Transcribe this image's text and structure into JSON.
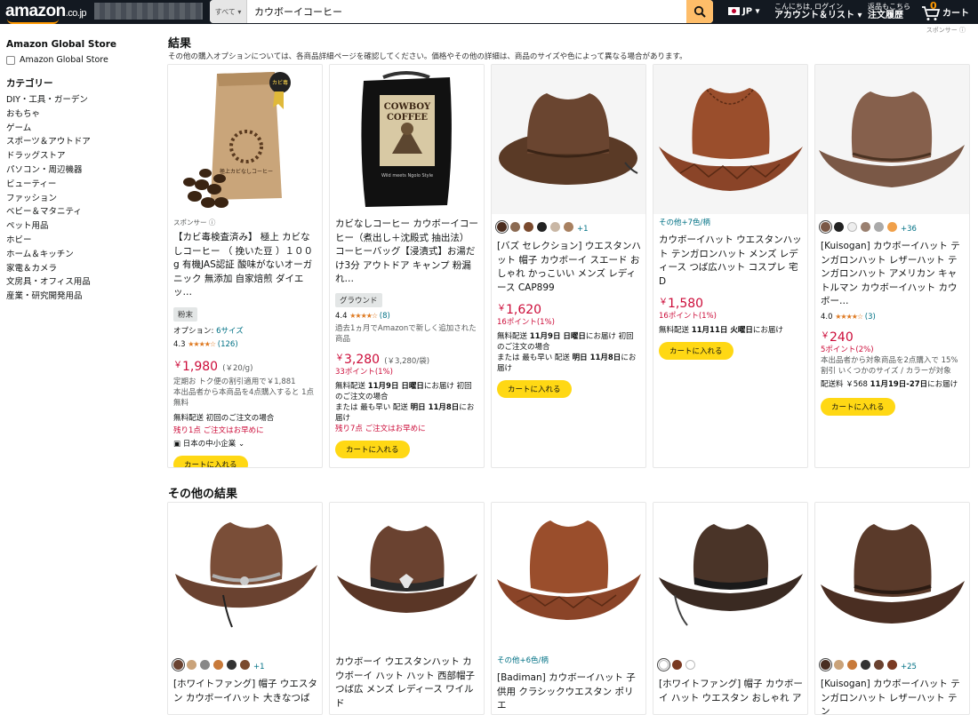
{
  "header": {
    "logo": "amazon",
    "logo_suffix": ".co.jp",
    "search_category": "すべて",
    "search_value": "カウボーイコーヒー",
    "lang": "JP",
    "greeting": "こんにちは, ログイン",
    "account": "アカウント＆リスト",
    "returns_line1": "返品もこちら",
    "returns_line2": "注文履歴",
    "cart_count": "0",
    "cart": "カート"
  },
  "sidebar": {
    "store_heading": "Amazon Global Store",
    "store_option": "Amazon Global Store",
    "category_heading": "カテゴリー",
    "categories": [
      "DIY・工具・ガーデン",
      "おもちゃ",
      "ゲーム",
      "スポーツ＆アウトドア",
      "ドラッグストア",
      "パソコン・周辺機器",
      "ビューティー",
      "ファッション",
      "ベビー＆マタニティ",
      "ペット用品",
      "ホビー",
      "ホーム＆キッチン",
      "家電＆カメラ",
      "文房具・オフィス用品",
      "産業・研究開発用品"
    ]
  },
  "results": {
    "heading": "結果",
    "subtitle": "その他の購入オプションについては、各商品詳細ページを確認してください。価格やその他の詳細は、商品のサイズや色によって異なる場合があります。",
    "sponsor_top": "スポンサー",
    "other_heading": "その他の結果"
  },
  "products": [
    {
      "sponsored": "スポンサー",
      "title": "【カビ毒検査済み】 極上 カビなしコーヒー （ 挽いた豆 ）１００g 有機JAS認証 酸味がないオーガニック 無添加 自家焙煎 ダイエッ…",
      "tag": "粉末",
      "options_label": "オプション:",
      "options_link": "6サイズ",
      "rating": "4.3",
      "reviews": "(126)",
      "price": "1,980",
      "unit": "(￥20/g)",
      "promo": "定期お トク便の割引適用で￥1,881",
      "promo2": "本出品者から本商品を4点購入すると 1点無料",
      "ship": "無料配送 初回のご注文の場合",
      "stock": "残り1点 ご注文はお早めに",
      "badge": "日本の中小企業",
      "cart": "カートに入れる",
      "image_text_1": "カビ毒",
      "image_text_2": "極上カビなしコーヒー"
    },
    {
      "title": "カビなしコーヒー カウボーイコーヒー（煮出し＋沈殿式 抽出法） コーヒーバッグ【浸漬式】お湯だけ3分 アウトドア キャンプ 粉漏れ…",
      "tag": "グラウンド",
      "rating": "4.4",
      "reviews": "(8)",
      "recent": "過去1ヵ月でAmazonで新しく追加された商品",
      "price": "3,280",
      "unit": "(￥3,280/袋)",
      "points": "33ポイント(1%)",
      "ship_pre": "無料配送",
      "ship_date": "11月9日 日曜日",
      "ship_post": "にお届け 初回のご注文の場合",
      "fast_pre": "または 最も早い 配送",
      "fast_date": "明日 11月8日",
      "fast_post": "にお届け",
      "stock": "残り7点 ご注文はお早めに",
      "cart": "カートに入れる",
      "image_line1": "COWBOY",
      "image_line2": "COFFEE",
      "image_line3": "Wild meets Ngolo Style"
    },
    {
      "more_colors": "+1",
      "title": "[バズ セレクション] ウエスタンハット 帽子 カウボーイ スエード おしゃれ かっこいい メンズ レディース CAP899",
      "price": "1,620",
      "points": "16ポイント(1%)",
      "ship_pre": "無料配送",
      "ship_date": "11月9日 日曜日",
      "ship_post": "にお届け 初回のご注文の場合",
      "fast_pre": "または 最も早い 配送",
      "fast_date": "明日 11月8日",
      "fast_post": "にお届け",
      "cart": "カートに入れる"
    },
    {
      "more_colors": "その他+7色/柄",
      "title": "カウボーイハット ウエスタンハット テンガロンハット メンズ レディース つば広ハット コスプレ 宅D",
      "price": "1,580",
      "points": "16ポイント(1%)",
      "ship_pre": "無料配送",
      "ship_date": "11月11日 火曜日",
      "ship_post": "にお届け",
      "cart": "カートに入れる"
    },
    {
      "more_colors": "+36",
      "title": "[Kuisogan] カウボーイハット テンガロンハット レザーハット テンガロンハット アメリカン キャトルマン カウボーイハット カウボー…",
      "rating": "4.0",
      "reviews": "(3)",
      "price": "240",
      "points": "5ポイント(2%)",
      "promo": "本出品者から対象商品を2点購入で 15%割引 いくつかのサイズ / カラーが対象",
      "ship_pre": "配送料 ￥568",
      "ship_date": "11月19日-27日",
      "ship_post": "にお届け",
      "cart": "カートに入れる"
    }
  ],
  "other": [
    {
      "more_colors": "+1",
      "title": "[ホワイトファング] 帽子 ウエスタン カウボーイハット 大きなつば"
    },
    {
      "title": "カウボーイ ウエスタンハット カウボーイ ハット ハット 西部帽子 つば広 メンズ レディース ワイルド"
    },
    {
      "more_colors": "その他+6色/柄",
      "title": "[Badiman] カウボーイハット 子供用 クラシックウエスタン ポリエ"
    },
    {
      "title": "[ホワイトファング] 帽子 カウボーイ ハット ウエスタン おしゃれ ア"
    },
    {
      "more_colors": "+25",
      "title": "[Kuisogan] カウボーイハット テンガロンハット レザーハット テン"
    }
  ],
  "colors": {
    "brand_dark": "#131921",
    "accent": "#ff9900",
    "cart_button": "#ffd814",
    "price_red": "#cc0c39",
    "link": "#007185"
  }
}
